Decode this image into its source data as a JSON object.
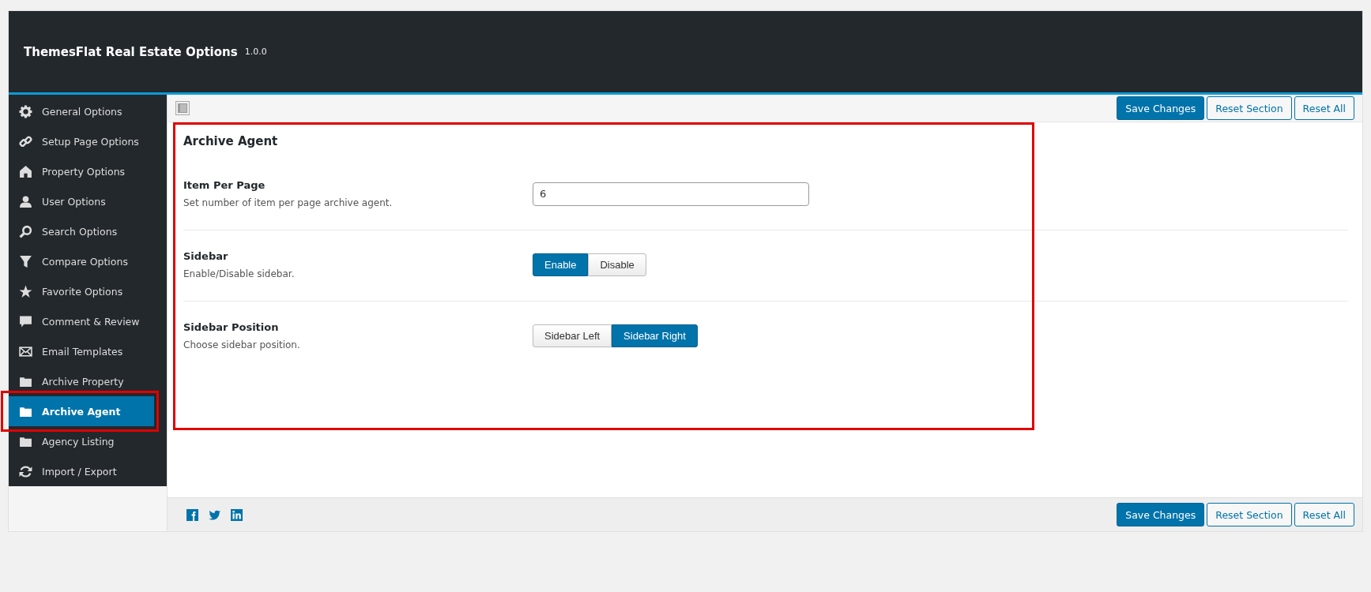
{
  "header": {
    "title": "ThemesFlat Real Estate Options",
    "version": "1.0.0"
  },
  "sidebar": {
    "items": [
      {
        "label": "General Options",
        "selected": false,
        "highlighted": false
      },
      {
        "label": "Setup Page Options",
        "selected": false,
        "highlighted": false
      },
      {
        "label": "Property Options",
        "selected": false,
        "highlighted": false
      },
      {
        "label": "User Options",
        "selected": false,
        "highlighted": false
      },
      {
        "label": "Search Options",
        "selected": false,
        "highlighted": false
      },
      {
        "label": "Compare Options",
        "selected": false,
        "highlighted": false
      },
      {
        "label": "Favorite Options",
        "selected": false,
        "highlighted": false
      },
      {
        "label": "Comment & Review",
        "selected": false,
        "highlighted": false
      },
      {
        "label": "Email Templates",
        "selected": false,
        "highlighted": false
      },
      {
        "label": "Archive Property",
        "selected": false,
        "highlighted": false
      },
      {
        "label": "Archive Agent",
        "selected": true,
        "highlighted": true
      },
      {
        "label": "Agency Listing",
        "selected": false,
        "highlighted": false
      },
      {
        "label": "Import / Export",
        "selected": false,
        "highlighted": false
      }
    ]
  },
  "toolbar": {
    "buttons": [
      {
        "label": "Save Changes",
        "kind": "primary"
      },
      {
        "label": "Reset Section",
        "kind": "secondary"
      },
      {
        "label": "Reset All",
        "kind": "secondary"
      }
    ]
  },
  "section": {
    "title": "Archive Agent",
    "highlighted": true,
    "fields": [
      {
        "kind": "text",
        "label": "Item Per Page",
        "description": "Set number of item per page archive agent.",
        "value": "6"
      },
      {
        "kind": "buttonset",
        "label": "Sidebar",
        "description": "Enable/Disable sidebar.",
        "options": [
          {
            "label": "Enable",
            "selected": true
          },
          {
            "label": "Disable",
            "selected": false
          }
        ]
      },
      {
        "kind": "buttonset",
        "label": "Sidebar Position",
        "description": "Choose sidebar position.",
        "options": [
          {
            "label": "Sidebar Left",
            "selected": false
          },
          {
            "label": "Sidebar Right",
            "selected": true
          }
        ]
      }
    ]
  },
  "footer": {
    "buttons": [
      {
        "label": "Save Changes",
        "kind": "primary"
      },
      {
        "label": "Reset Section",
        "kind": "secondary"
      },
      {
        "label": "Reset All",
        "kind": "secondary"
      }
    ]
  }
}
